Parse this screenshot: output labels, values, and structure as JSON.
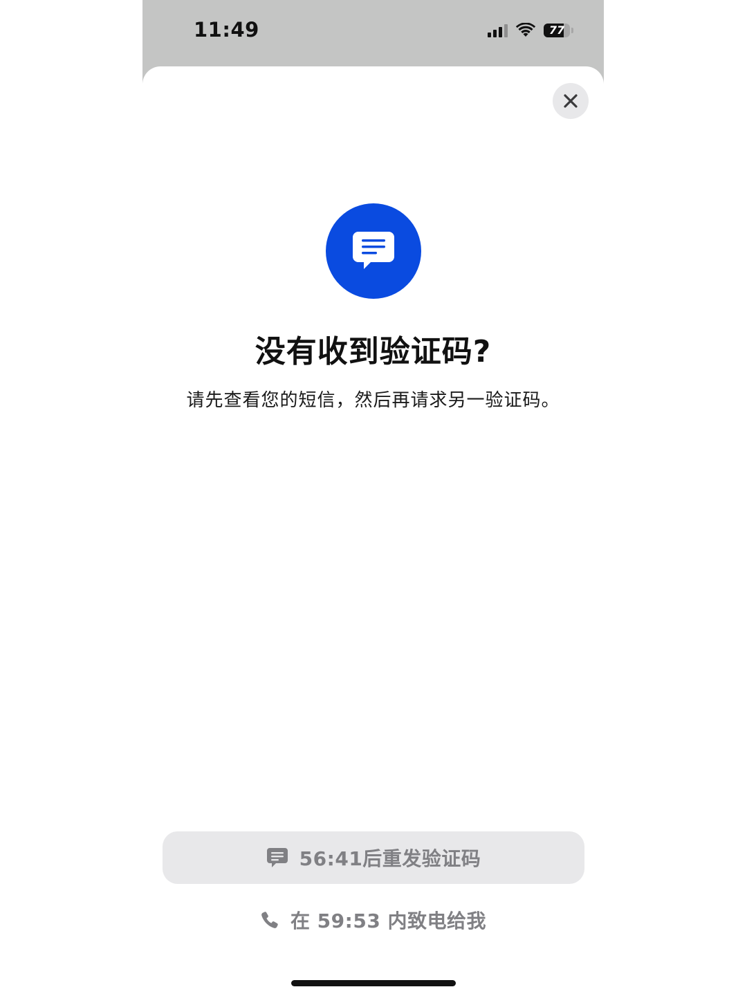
{
  "status_bar": {
    "time": "11:49",
    "battery_percent": "77",
    "battery_level": 0.77,
    "signal_bars": 3,
    "signal_bars_total": 4
  },
  "sheet": {
    "title": "没有收到验证码?",
    "subtitle": "请先查看您的短信，然后再请求另一验证码。",
    "hero_icon": "message-bubble-icon",
    "close_icon": "close-icon"
  },
  "actions": {
    "resend_label": "56:41后重发验证码",
    "resend_icon": "message-icon",
    "call_label": "在 59:53 内致电给我",
    "call_icon": "phone-icon"
  },
  "colors": {
    "accent": "#0a4be0",
    "button_bg": "#e8e8ea",
    "disabled_text": "#808084",
    "backdrop": "#c4c5c4"
  }
}
